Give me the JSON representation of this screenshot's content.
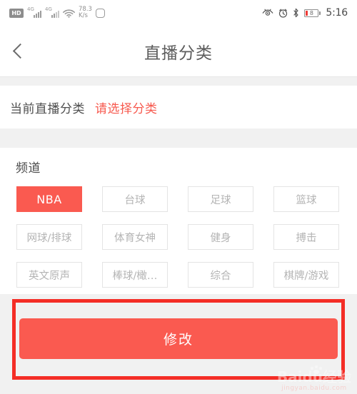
{
  "statusbar": {
    "hd_label": "HD",
    "sim1_gen": "4G",
    "sim2_gen": "4G",
    "network_speed": "78.3",
    "network_speed_unit": "K/s",
    "battery_level": "8",
    "time": "5:16",
    "icons": {
      "hd": "hd-badge-icon",
      "signal1": "signal-bars-icon",
      "signal2": "signal-bars-icon",
      "wifi": "wifi-icon",
      "rounded_square": "rounded-square-icon",
      "eye_protect": "eye-protection-icon",
      "alarm": "alarm-clock-icon",
      "bluetooth": "bluetooth-icon",
      "battery": "battery-icon"
    }
  },
  "titlebar": {
    "back_icon": "chevron-left-icon",
    "title": "直播分类"
  },
  "current": {
    "label": "当前直播分类",
    "value": "请选择分类"
  },
  "channel": {
    "section_title": "频道",
    "chips": [
      {
        "label": "NBA",
        "selected": true
      },
      {
        "label": "台球",
        "selected": false
      },
      {
        "label": "足球",
        "selected": false
      },
      {
        "label": "篮球",
        "selected": false
      },
      {
        "label": "网球/排球",
        "selected": false
      },
      {
        "label": "体育女神",
        "selected": false
      },
      {
        "label": "健身",
        "selected": false
      },
      {
        "label": "搏击",
        "selected": false
      },
      {
        "label": "英文原声",
        "selected": false
      },
      {
        "label": "棒球/橄…",
        "selected": false
      },
      {
        "label": "综合",
        "selected": false
      },
      {
        "label": "棋牌/游戏",
        "selected": false
      }
    ]
  },
  "submit": {
    "label": "修改"
  },
  "watermark": {
    "main": "Baidu经验",
    "sub": "jingyan.baidu.com"
  },
  "colors": {
    "accent_red": "#fa5a50",
    "annotation_red": "#f42d26",
    "page_bg": "#f1f1f1",
    "card_bg": "#ffffff",
    "chip_border": "#e4e4e4",
    "chip_text": "#b4b4b4"
  }
}
